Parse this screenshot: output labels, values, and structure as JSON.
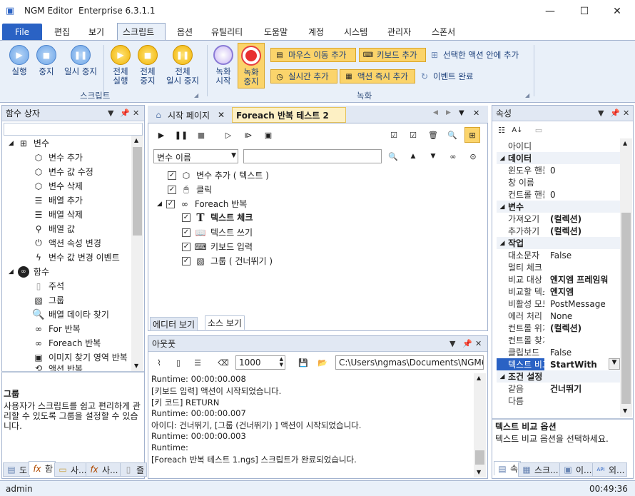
{
  "titlebar": {
    "app": "NGM Editor",
    "edition": "Enterprise 6.3.1.1",
    "min": "—",
    "max": "☐",
    "close": "✕"
  },
  "menu": {
    "file": "File",
    "items": [
      "편집",
      "보기",
      "스크립트",
      "옵션",
      "유틸리티",
      "도움말",
      "계정",
      "시스템",
      "관리자",
      "스폰서"
    ]
  },
  "ribbon": {
    "script_group": "스크립트",
    "record_group": "녹화",
    "run": "실행",
    "stop": "중지",
    "pause_l1": "일시",
    "pause_l2": "중지",
    "all_run_l1": "전체",
    "all_run_l2": "실행",
    "all_stop_l1": "전체",
    "all_stop_l2": "중지",
    "all_pause_l1": "전체",
    "all_pause_l2": "일시 중지",
    "rec_start_l1": "녹화",
    "rec_start_l2": "시작",
    "rec_stop_l1": "녹화",
    "rec_stop_l2": "중지",
    "add_mouse": "마우스 이동 추가",
    "add_keyboard": "키보드 추가",
    "add_inside": "선택한 액션 안에 추가",
    "add_realtime": "실시간 추가",
    "add_action_now": "액션 즉시 추가",
    "event_done": "이벤트 완료"
  },
  "func_box": {
    "title": "함수 상자",
    "groups": [
      {
        "label": "변수",
        "items": [
          "변수 추가",
          "변수 값 수정",
          "변수 삭제",
          "배열 추가",
          "배열 삭제",
          "배열 값",
          "액션 속성 변경",
          "변수 값 변경 이벤트"
        ]
      },
      {
        "label": "함수",
        "items": [
          "주석",
          "그룹",
          "배열 데이타 찾기",
          "For 반복",
          "Foreach 반복",
          "이미지 찾기 영역 반복",
          "액션 반복"
        ]
      }
    ],
    "desc_title": "그룹",
    "desc_text": "사용자가 스크립트를 쉽고 편리하게 관리할 수 있도록 그룹을 설정할 수 있습니다.",
    "bottom_tabs": [
      "도",
      "함",
      "사...",
      "사...",
      "즐"
    ]
  },
  "editor": {
    "tabs": [
      "시작 페이지",
      "Foreach 반복 테스트 2"
    ],
    "search_select": "변수 이름",
    "search_value": "",
    "tree": [
      {
        "label": "변수 추가 ( 텍스트 )",
        "bold": false
      },
      {
        "label": "클릭",
        "bold": false
      },
      {
        "label": "Foreach 반복",
        "bold": false
      },
      {
        "label": "텍스트 체크",
        "bold": true
      },
      {
        "label": "텍스트 쓰기",
        "bold": false
      },
      {
        "label": "키보드 입력",
        "bold": false
      },
      {
        "label": "그룹 ( 건너뛰기 )",
        "bold": false
      }
    ],
    "view_tabs": [
      "에디터 보기",
      "소스 보기"
    ]
  },
  "output": {
    "title": "아웃풋",
    "count": "1000",
    "path": "C:\\Users\\ngmas\\Documents\\NGM6\\",
    "lines": [
      "Runtime: 00:00:00.008",
      "[키보드 입력] 액션이 시작되었습니다.",
      "[키 코드] RETURN",
      "Runtime: 00:00:00.007",
      "아이디: 건너뛰기, [그룹 (건너뛰기) ] 액션이 시작되었습니다.",
      "Runtime: 00:00:00.003",
      "Runtime:",
      "[Foreach 반복 테스트 1.ngs] 스크립트가 완료되었습니다."
    ]
  },
  "props": {
    "title": "속성",
    "rows": [
      {
        "type": "row",
        "k": "아이디",
        "v": ""
      },
      {
        "type": "cat",
        "k": "데이터"
      },
      {
        "type": "row",
        "k": "윈도우 핸들",
        "v": "0"
      },
      {
        "type": "row",
        "k": "창 이름",
        "v": ""
      },
      {
        "type": "row",
        "k": "컨트롤 핸들",
        "v": "0"
      },
      {
        "type": "cat",
        "k": "변수"
      },
      {
        "type": "row",
        "k": "가져오기",
        "v": "(컬렉션)",
        "bold": true
      },
      {
        "type": "row",
        "k": "추가하기",
        "v": "(컬렉션)",
        "bold": true
      },
      {
        "type": "cat",
        "k": "작업"
      },
      {
        "type": "row",
        "k": "대소문자",
        "v": "False"
      },
      {
        "type": "row",
        "k": "멀티 체크",
        "v": ""
      },
      {
        "type": "row",
        "k": "비교 대상",
        "v": "엔지엠 프레임워",
        "bold": true
      },
      {
        "type": "row",
        "k": "비교할 텍스트",
        "v": "엔지엠",
        "bold": true
      },
      {
        "type": "row",
        "k": "비활성 모드",
        "v": "PostMessage"
      },
      {
        "type": "row",
        "k": "에러 처리",
        "v": "None"
      },
      {
        "type": "row",
        "k": "컨트롤 위치",
        "v": "(컬렉션)",
        "bold": true
      },
      {
        "type": "row",
        "k": "컨트롤 찾기",
        "v": ""
      },
      {
        "type": "row",
        "k": "클립보드",
        "v": "False"
      },
      {
        "type": "row",
        "k": "텍스트 비교",
        "v": "StartWith",
        "bold": true,
        "selected": true
      },
      {
        "type": "cat",
        "k": "조건 설정"
      },
      {
        "type": "row",
        "k": "같음",
        "v": "건너뛰기",
        "bold": true
      },
      {
        "type": "row",
        "k": "다름",
        "v": ""
      }
    ],
    "desc_title": "텍스트 비교 옵션",
    "desc_text": "텍스트 비교 옵션을 선택하세요.",
    "bottom_tabs": [
      "속",
      "스크...",
      "이...",
      "외..."
    ]
  },
  "status": {
    "user": "admin",
    "time": "00:49:36"
  }
}
